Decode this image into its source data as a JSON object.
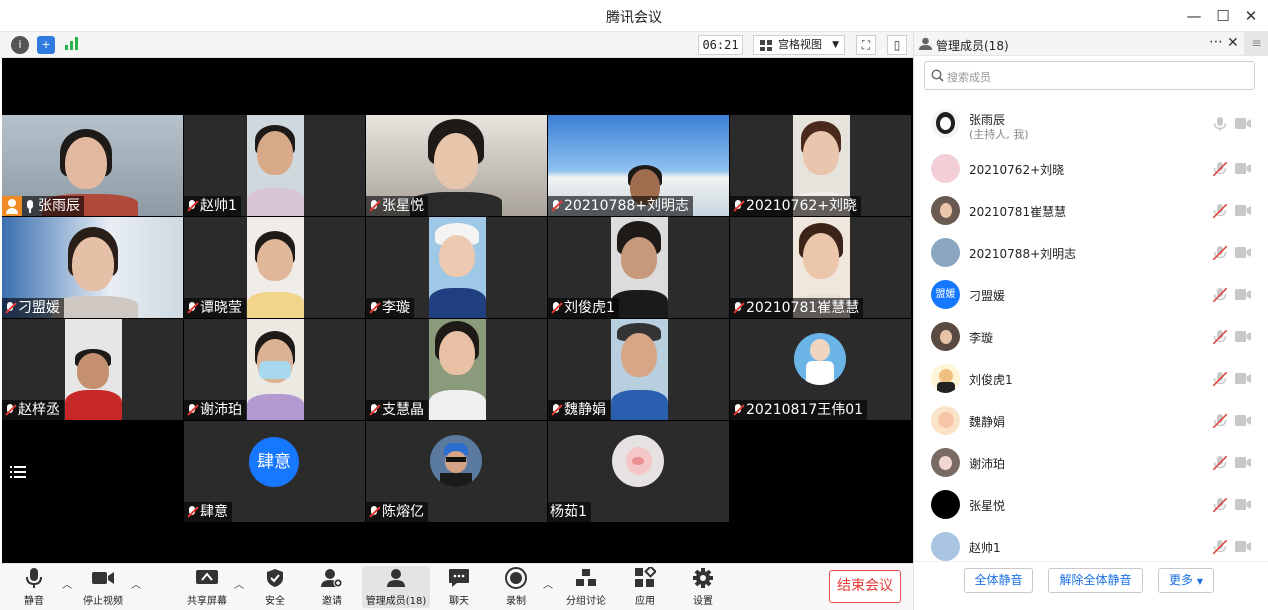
{
  "window": {
    "title": "腾讯会议"
  },
  "toolbar": {
    "timer": "06:21",
    "view_mode": "宫格视图"
  },
  "tiles": [
    {
      "name": "张雨辰",
      "host": true,
      "muted": false
    },
    {
      "name": "赵帅1",
      "muted": true
    },
    {
      "name": "张星悦",
      "muted": true
    },
    {
      "name": "20210788+刘明志",
      "muted": true
    },
    {
      "name": "20210762+刘晓",
      "muted": true
    },
    {
      "name": "刁盟媛",
      "muted": true
    },
    {
      "name": "谭晓莹",
      "muted": true
    },
    {
      "name": "李璇",
      "muted": true
    },
    {
      "name": "刘俊虎1",
      "muted": true
    },
    {
      "name": "20210781崔慧慧",
      "muted": true
    },
    {
      "name": "赵梓丞",
      "muted": true
    },
    {
      "name": "谢沛珀",
      "muted": true
    },
    {
      "name": "支慧晶",
      "muted": true
    },
    {
      "name": "魏静娟",
      "muted": true
    },
    {
      "name": "20210817王伟01",
      "muted": true
    },
    {
      "name": "肆意",
      "muted": true,
      "avatar_text": "肆意"
    },
    {
      "name": "陈熔亿",
      "muted": true
    },
    {
      "name": "杨茹1",
      "muted": false
    }
  ],
  "bottombar": {
    "mute": "静音",
    "stop_video": "停止视频",
    "share_screen": "共享屏幕",
    "security": "安全",
    "invite": "邀请",
    "manage_members": "管理成员(18)",
    "chat": "聊天",
    "record": "录制",
    "breakout": "分组讨论",
    "apps": "应用",
    "settings": "设置",
    "end_meeting": "结束会议"
  },
  "panel": {
    "title": "管理成员(18)",
    "search_placeholder": "搜索成员",
    "members": [
      {
        "name": "张雨辰",
        "sub": "(主持人, 我)"
      },
      {
        "name": "20210762+刘晓"
      },
      {
        "name": "20210781崔慧慧"
      },
      {
        "name": "20210788+刘明志"
      },
      {
        "name": "刁盟媛",
        "avatar_text": "盟媛"
      },
      {
        "name": "李璇"
      },
      {
        "name": "刘俊虎1"
      },
      {
        "name": "魏静娟"
      },
      {
        "name": "谢沛珀"
      },
      {
        "name": "张星悦"
      },
      {
        "name": "赵帅1"
      }
    ],
    "mute_all": "全体静音",
    "unmute_all": "解除全体静音",
    "more": "更多"
  },
  "colors": {
    "accent": "#1a6fe3",
    "end": "#e53935",
    "host_badge": "#f08a24"
  }
}
